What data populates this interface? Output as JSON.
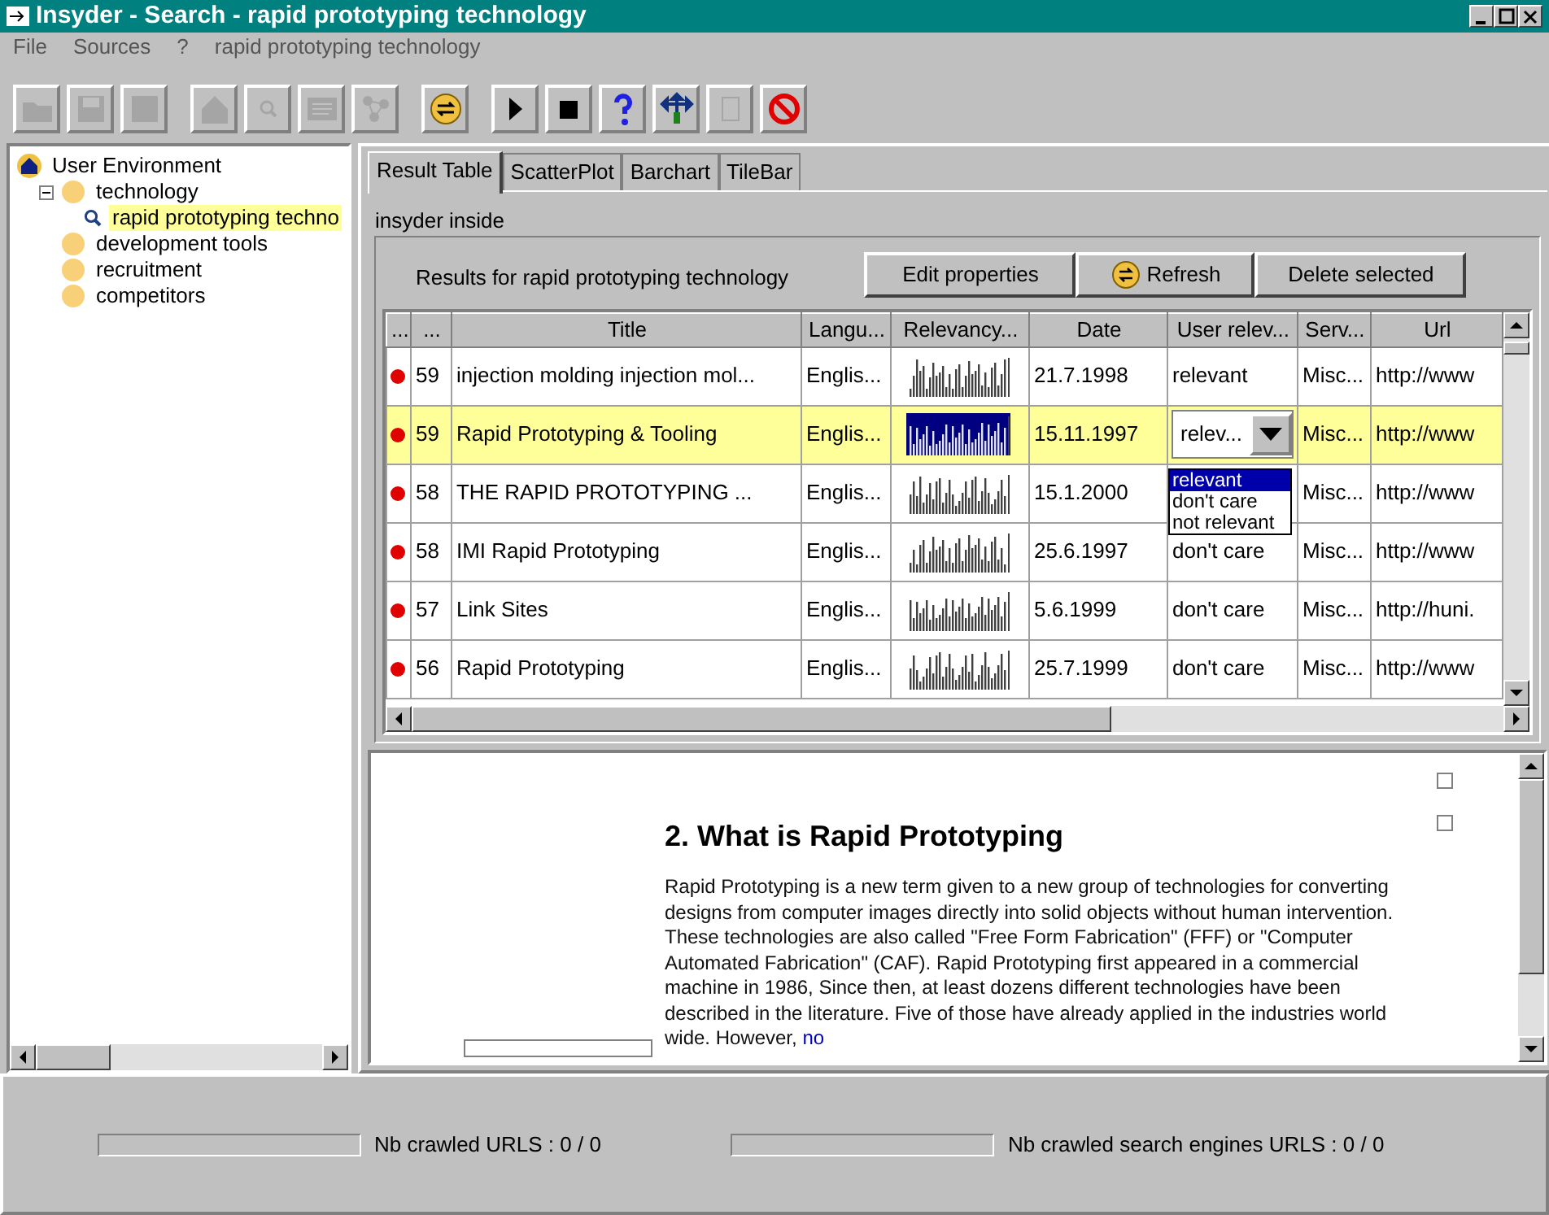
{
  "window": {
    "title": "Insyder - Search - rapid prototyping technology"
  },
  "menu": [
    "File",
    "Sources",
    "?",
    "rapid prototyping technology"
  ],
  "toolbar": [
    {
      "kind": "folder",
      "disabled": true
    },
    {
      "kind": "disk",
      "disabled": true
    },
    {
      "kind": "blank",
      "disabled": true
    },
    {
      "kind": "house",
      "disabled": true
    },
    {
      "kind": "magnifier",
      "disabled": true
    },
    {
      "kind": "document",
      "disabled": true
    },
    {
      "kind": "network",
      "disabled": true
    },
    {
      "kind": "refresh",
      "disabled": false
    },
    {
      "kind": "play",
      "disabled": false
    },
    {
      "kind": "stop",
      "disabled": false
    },
    {
      "kind": "help",
      "disabled": false
    },
    {
      "kind": "arrows",
      "disabled": false
    },
    {
      "kind": "page",
      "disabled": true
    },
    {
      "kind": "forbidden",
      "disabled": false
    }
  ],
  "tree": {
    "label": "User Environment",
    "selected": false,
    "children": [
      {
        "label": "technology",
        "selected": false,
        "expanded": true,
        "children": [
          {
            "label": "rapid prototyping techno",
            "selected": true
          }
        ]
      },
      {
        "label": "development tools",
        "selected": false
      },
      {
        "label": "recruitment",
        "selected": false
      },
      {
        "label": "competitors",
        "selected": false
      }
    ]
  },
  "tabs": [
    {
      "label": "Result Table",
      "selected": true
    },
    {
      "label": "ScatterPlot",
      "selected": false
    },
    {
      "label": "Barchart",
      "selected": false
    },
    {
      "label": "TileBar",
      "selected": false
    }
  ],
  "group_label": "insyder inside",
  "results_label": "Results for rapid prototyping technology",
  "buttons": [
    {
      "label": "Edit properties",
      "kind": "plain"
    },
    {
      "label": "Refresh",
      "kind": "refresh"
    },
    {
      "label": "Delete selected",
      "kind": "plain"
    }
  ],
  "table": {
    "columns": [
      "...",
      "...",
      "Title",
      "Langu...",
      "Relevancy...",
      "Date",
      "User relev...",
      "Serv...",
      "Url"
    ],
    "rows": [
      {
        "color": "#e00000",
        "rank": "59",
        "title": "injection molding injection mol...",
        "language": "Englis...",
        "date": "21.7.1998",
        "user_relevance": "relevant",
        "server": "Misc...",
        "url": "http://www",
        "selected": false
      },
      {
        "color": "#e00000",
        "rank": "59",
        "title": "Rapid Prototyping & Tooling",
        "language": "Englis...",
        "date": "15.11.1997",
        "user_relevance": "relev...",
        "server": "Misc...",
        "url": "http://www",
        "selected": true,
        "dropdown_options": [
          {
            "label": "relevant",
            "selected": true
          },
          {
            "label": "don't care",
            "selected": false
          },
          {
            "label": "not relevant",
            "selected": false
          }
        ]
      },
      {
        "color": "#e00000",
        "rank": "58",
        "title": "THE RAPID PROTOTYPING ...",
        "language": "Englis...",
        "date": "15.1.2000",
        "server": "Misc...",
        "url": "http://www",
        "selected": false
      },
      {
        "color": "#e00000",
        "rank": "58",
        "title": "IMI Rapid Prototyping",
        "language": "Englis...",
        "date": "25.6.1997",
        "user_relevance": "don't care",
        "server": "Misc...",
        "url": "http://www",
        "selected": false
      },
      {
        "color": "#e00000",
        "rank": "57",
        "title": "Link Sites",
        "language": "Englis...",
        "date": "5.6.1999",
        "user_relevance": "don't care",
        "server": "Misc...",
        "url": "http://huni.",
        "selected": false
      },
      {
        "color": "#e00000",
        "rank": "56",
        "title": "Rapid Prototyping",
        "language": "Englis...",
        "date": "25.7.1999",
        "user_relevance": "don't care",
        "server": "Misc...",
        "url": "http://www",
        "selected": false
      }
    ]
  },
  "document": {
    "checkboxes": [
      {
        "checked": false
      },
      {
        "checked": false
      }
    ],
    "heading": "2. What is Rapid Prototyping",
    "paragraph": "Rapid Prototyping is a new term given to a new group of technologies for converting designs from computer images directly into solid objects without human intervention. These technologies are also called \"Free Form Fabrication\" (FFF) or \"Computer Automated Fabrication\" (CAF). Rapid Prototyping first appeared in a commercial machine in 1986, Since then, at least dozens different technologies have been described in the literature. Five of those have already applied in the industries world wide. However,",
    "link": "no"
  },
  "status_bar": [
    {
      "label": "Nb crawled URLS : 0 / 0",
      "level": 0
    },
    {
      "label": "Nb crawled search engines URLS : 0 / 0",
      "level": 0
    }
  ]
}
